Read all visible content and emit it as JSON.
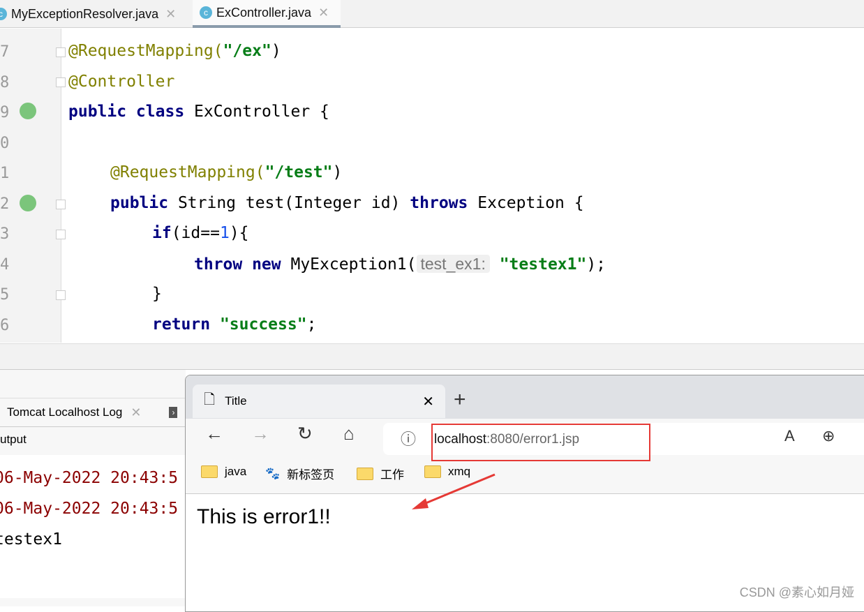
{
  "editor": {
    "tabs": [
      {
        "label": "MyExceptionResolver.java"
      },
      {
        "label": "ExController.java"
      }
    ],
    "line_numbers": [
      "7",
      "8",
      "9",
      "0",
      "1",
      "2",
      "3",
      "4",
      "5",
      "6"
    ],
    "code": {
      "l7a": "@RequestMapping(",
      "l7b": "\"/ex\"",
      "l7c": ")",
      "l8": "@Controller",
      "l9a": "public class ",
      "l9b": "ExController {",
      "l11a": "@RequestMapping(",
      "l11b": "\"/test\"",
      "l11c": ")",
      "l12a": "public ",
      "l12b": "String test(Integer id) ",
      "l12c": "throws ",
      "l12d": "Exception {",
      "l13a": "if",
      "l13b": "(id==",
      "l13c": "1",
      "l13d": "){",
      "l14a": "throw new ",
      "l14b": "MyException1(",
      "l14hint": "test_ex1:",
      "l14c": "\"testex1\"",
      "l14d": ");",
      "l15": "}",
      "l16a": "return ",
      "l16b": "\"success\"",
      "l16c": ";"
    }
  },
  "bottom_panel": {
    "tab": "Tomcat Localhost Log",
    "output_label": "utput",
    "lines": [
      "06-May-2022 20:43:5",
      "06-May-2022 20:43:5",
      "testex1"
    ]
  },
  "browser": {
    "tab_title": "Title",
    "url_host": "localhost",
    "url_rest": ":8080/error1.jsp",
    "bookmarks": [
      "java",
      "新标签页",
      "工作",
      "xmq"
    ],
    "page_text": "This is error1!!"
  },
  "watermark": "CSDN @素心如月娅"
}
